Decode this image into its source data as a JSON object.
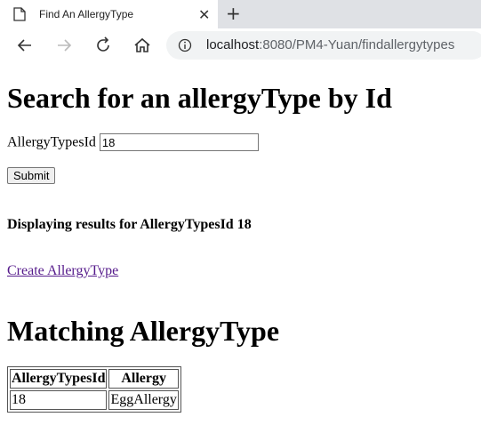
{
  "browser": {
    "tab_title": "Find An AllergyType",
    "close_glyph": "✕",
    "new_tab_glyph": "+",
    "url_host": "localhost",
    "url_path": ":8080/PM4-Yuan/findallergytypes"
  },
  "page": {
    "heading": "Search for an allergyType by Id",
    "field_label": "AllergyTypesId",
    "field_value": "18",
    "submit_label": "Submit",
    "result_message": "Displaying results for AllergyTypesId 18",
    "create_link": "Create AllergyType",
    "matching_heading": "Matching AllergyType",
    "table": {
      "headers": [
        "AllergyTypesId",
        "Allergy"
      ],
      "rows": [
        [
          "18",
          "EggAllergy"
        ]
      ]
    }
  },
  "colors": {
    "tabstrip": "#dfe1e5",
    "omnibox": "#f1f3f4",
    "visited_link": "#551a8b"
  }
}
